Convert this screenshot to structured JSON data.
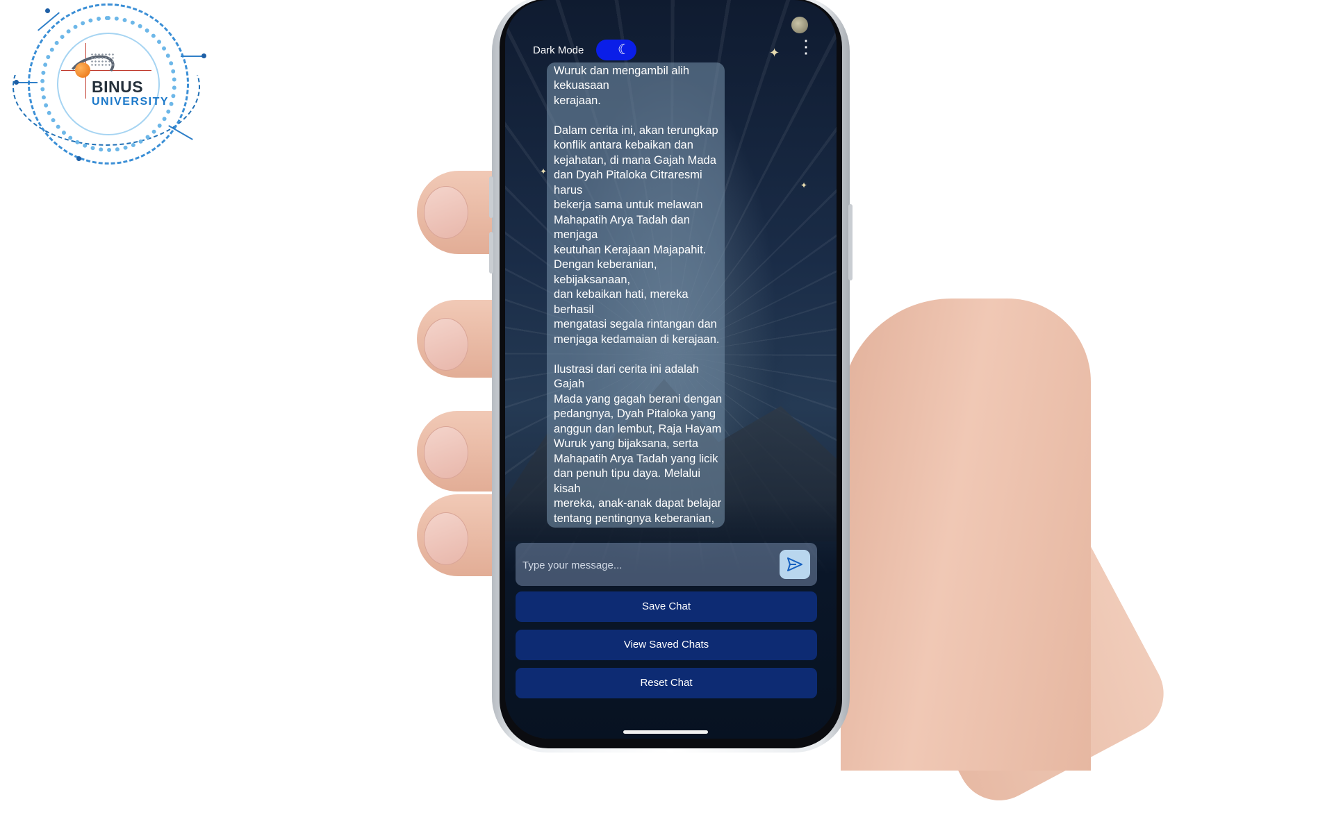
{
  "logo": {
    "name": "BINUS",
    "subtitle": "UNIVERSITY"
  },
  "app": {
    "dark_mode_label": "Dark Mode",
    "dark_mode_on": true,
    "toggle_icon": "moon-icon",
    "menu_icon": "more-vertical-icon"
  },
  "chat": {
    "message_text": "untuk menjatuhkan Raja Hayam\nWuruk dan mengambil alih kekuasaan\nkerajaan.\n\nDalam cerita ini, akan terungkap\nkonflik antara kebaikan dan\nkejahatan, di mana Gajah Mada\ndan Dyah Pitaloka Citraresmi harus\nbekerja sama untuk melawan\nMahapatih Arya Tadah dan menjaga\nkeutuhan Kerajaan Majapahit.\nDengan keberanian, kebijaksanaan,\ndan kebaikan hati, mereka berhasil\nmengatasi segala rintangan dan\nmenjaga kedamaian di kerajaan.\n\nIlustrasi dari cerita ini adalah Gajah\nMada yang gagah berani dengan\npedangnya, Dyah Pitaloka yang\nanggun dan lembut, Raja Hayam\nWuruk yang bijaksana, serta\nMahapatih Arya Tadah yang licik\ndan penuh tipu daya. Melalui kisah\nmereka, anak-anak dapat belajar\ntentang pentingnya keberanian,\nkebaikan hati, dan kerja sama dalam\nmenghadapi berbagai tantangan\ndalam kehidupan. Semoga cerita ini\ndapat menginspirasi anak-anak untuk\nselalu berbuat baik dan berjuang\nmelawan kejahatan."
  },
  "input": {
    "placeholder": "Type your message...",
    "value": "",
    "send_icon": "send-icon"
  },
  "buttons": {
    "save": "Save Chat",
    "view_saved": "View Saved Chats",
    "reset": "Reset Chat"
  },
  "colors": {
    "toggle_on": "#0a1ee8",
    "button_bg": "#0d2b73",
    "send_bg": "#b9d6ee"
  }
}
